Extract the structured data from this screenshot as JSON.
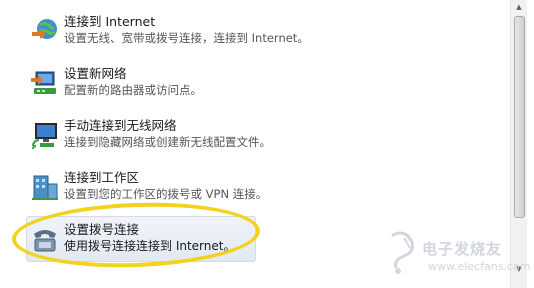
{
  "options": [
    {
      "title": "连接到 Internet",
      "desc": "设置无线、宽带或拨号连接，连接到 Internet。",
      "icon": "globe-connect-icon"
    },
    {
      "title": "设置新网络",
      "desc": "配置新的路由器或访问点。",
      "icon": "router-setup-icon"
    },
    {
      "title": "手动连接到无线网络",
      "desc": "连接到隐藏网络或创建新无线配置文件。",
      "icon": "wireless-monitor-icon"
    },
    {
      "title": "连接到工作区",
      "desc": "设置到您的工作区的拨号或 VPN 连接。",
      "icon": "workplace-building-icon"
    },
    {
      "title": "设置拨号连接",
      "desc": "使用拨号连接连接到 Internet。",
      "icon": "dialup-phone-icon"
    }
  ],
  "watermark": {
    "text": "电子发烧友",
    "url": "www.elecfans.com"
  },
  "colors": {
    "highlight_ellipse": "#f2d21a",
    "selected_bg": "#e8eef6"
  }
}
